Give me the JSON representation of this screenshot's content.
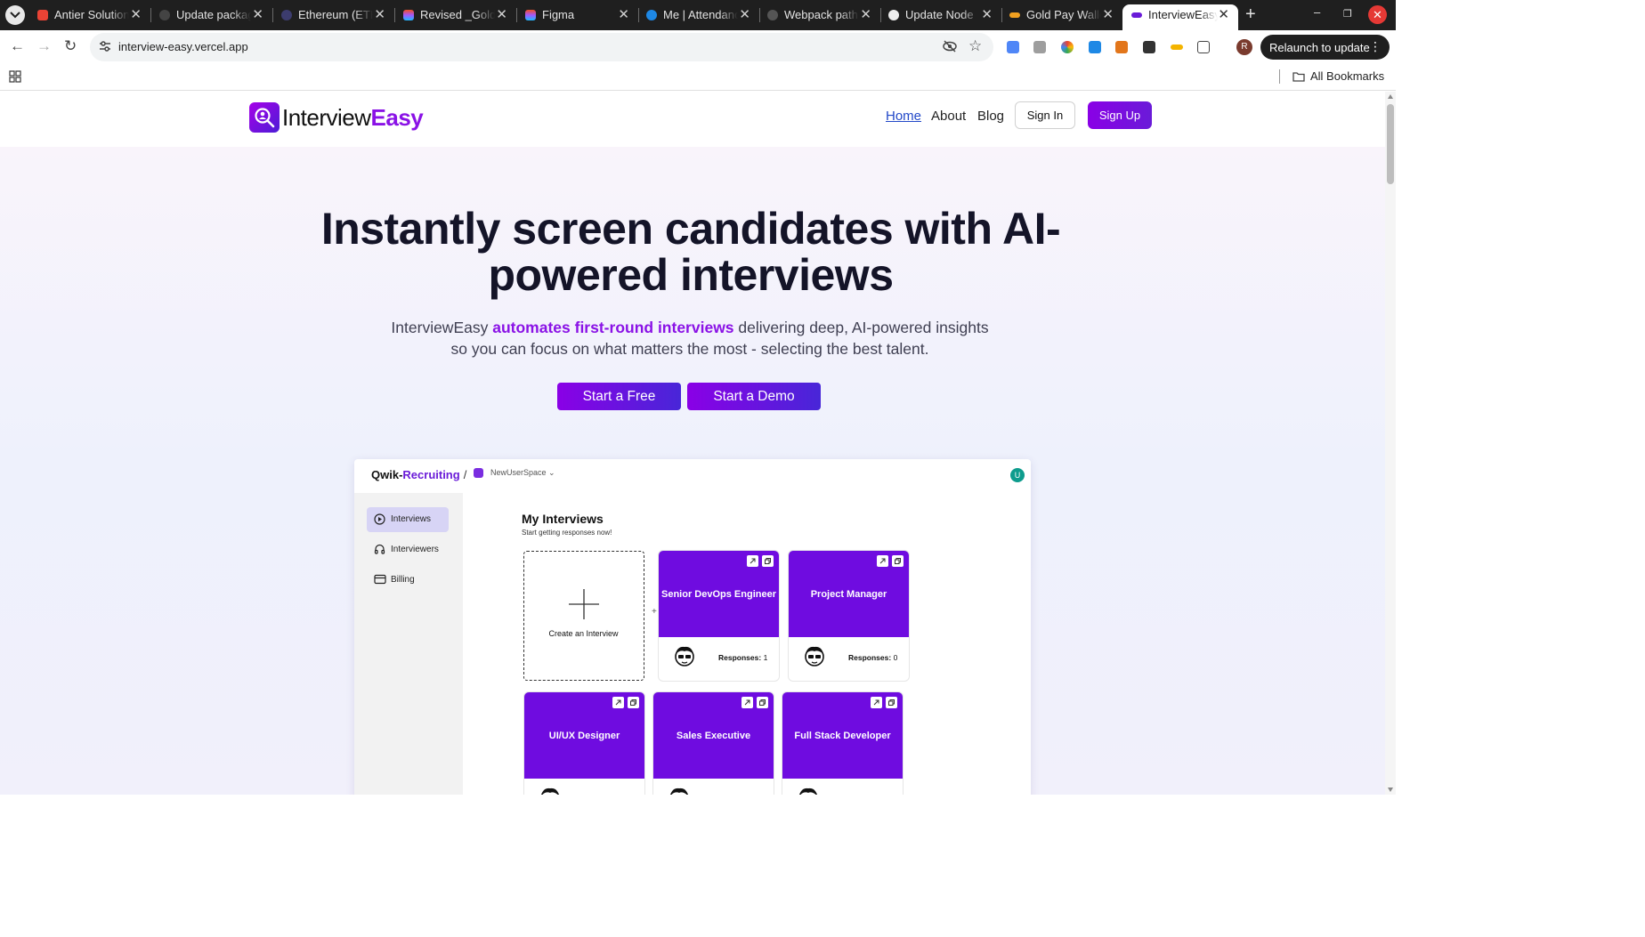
{
  "browser": {
    "tabs": [
      {
        "title": "Antier Solutions",
        "favicon_color": "#ea4335"
      },
      {
        "title": "Update packages",
        "favicon_color": "#444444"
      },
      {
        "title": "Ethereum (ETH)",
        "favicon_color": "#3c3c6e"
      },
      {
        "title": "Revised _Gold",
        "favicon_color": "#f24e1e"
      },
      {
        "title": "Figma",
        "favicon_color": "#a259ff"
      },
      {
        "title": "Me | Attendance",
        "favicon_color": "#1e88e5"
      },
      {
        "title": "Webpack path",
        "favicon_color": "#555555"
      },
      {
        "title": "Update Node",
        "favicon_color": "#eeeeee"
      },
      {
        "title": "Gold Pay Wallet",
        "favicon_color": "#f0a020"
      },
      {
        "title": "InterviewEasy",
        "favicon_color": "#6a1bd8",
        "active": true
      }
    ],
    "url": "interview-easy.vercel.app",
    "relaunch_label": "Relaunch to update",
    "profile_initial": "R",
    "bookmarks_label": "All Bookmarks"
  },
  "site": {
    "logo": {
      "part1": "Interview",
      "part2": "Easy"
    },
    "nav": {
      "home": "Home",
      "about": "About",
      "blog": "Blog",
      "sign_in": "Sign In",
      "sign_up": "Sign Up"
    },
    "hero": {
      "title": "Instantly screen candidates with AI-powered interviews",
      "sub_prefix": "InterviewEasy",
      "sub_highlight": "automates first-round interviews",
      "sub_suffix": "delivering deep, AI-powered insights so you can focus on what matters the most - selecting the best talent.",
      "cta_free": "Start a Free",
      "cta_demo": "Start a Demo"
    },
    "accent_color": "#8a12e6"
  },
  "preview": {
    "brand_part1": "Qwik-",
    "brand_part2": "Recruiting",
    "brand_slash": "/",
    "workspace": "NewUserSpace",
    "avatar_initial": "U",
    "sidebar": [
      {
        "label": "Interviews",
        "icon": "play-circle-icon",
        "active": true
      },
      {
        "label": "Interviewers",
        "icon": "headset-icon"
      },
      {
        "label": "Billing",
        "icon": "credit-card-icon"
      }
    ],
    "heading": "My Interviews",
    "subheading": "Start getting responses now!",
    "create_label": "Create an Interview",
    "responses_label": "Responses:",
    "cards": [
      {
        "title": "Senior DevOps Engineer",
        "responses": "1"
      },
      {
        "title": "Project Manager",
        "responses": "0"
      },
      {
        "title": "UI/UX Designer"
      },
      {
        "title": "Sales Executive"
      },
      {
        "title": "Full Stack Developer"
      }
    ],
    "card_color": "#6f0ce0"
  }
}
